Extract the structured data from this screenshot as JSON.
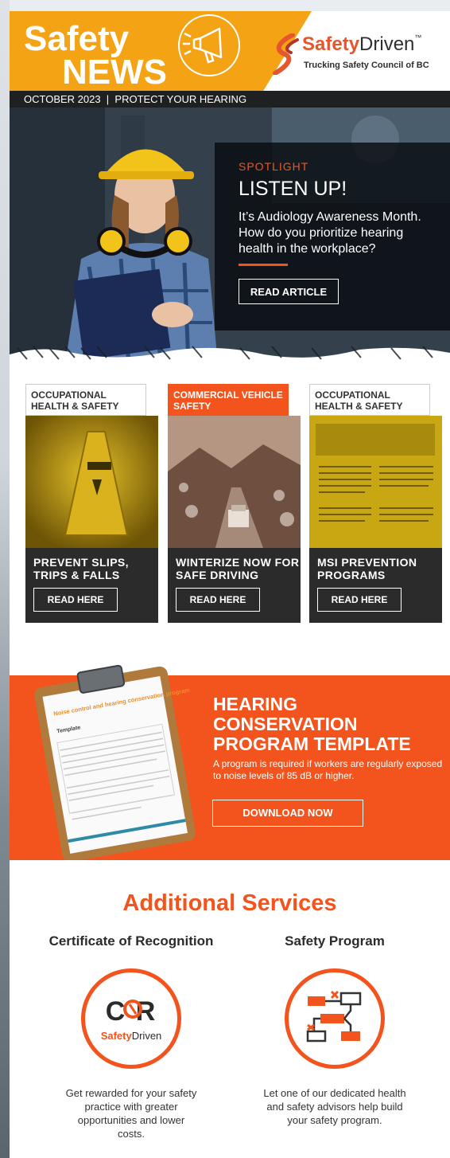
{
  "header": {
    "title_line1": "Safety",
    "title_line2": "NEWS",
    "brand_word1": "Safety",
    "brand_word2": "Driven",
    "brand_tm": "™",
    "brand_sub": "Trucking Safety Council of BC",
    "date_line": "OCTOBER 2023  |  PROTECT YOUR HEARING",
    "colors": {
      "orange": "#f3a313",
      "accent": "#f3541d",
      "dark": "#1f2022"
    }
  },
  "spotlight": {
    "label": "SPOTLIGHT",
    "title": "LISTEN UP!",
    "text": "It’s Audiology Awareness Month. How do you prioritize hearing health in the workplace?",
    "button": "READ ARTICLE"
  },
  "cards": [
    {
      "tab": "OCCUPATIONAL HEALTH & SAFETY",
      "heading": "PREVENT SLIPS, TRIPS & FALLS",
      "button": "READ HERE",
      "tab_style": "white",
      "image_icon": "caution-sign-image"
    },
    {
      "tab": "COMMERCIAL VEHICLE SAFETY",
      "heading": "WINTERIZE NOW FOR SAFE DRIVING",
      "button": "READ HERE",
      "tab_style": "orange",
      "image_icon": "winter-truck-image"
    },
    {
      "tab": "OCCUPATIONAL HEALTH & SAFETY",
      "heading": "MSI PREVENTION PROGRAMS",
      "button": "READ HERE",
      "tab_style": "white",
      "image_icon": "document-preview-image"
    }
  ],
  "hearing": {
    "title": "HEARING CONSERVATION PROGRAM TEMPLATE",
    "text": "A program is required if workers are regularly exposed to noise levels of 85 dB or higher.",
    "button": "DOWNLOAD NOW",
    "clipboard_doc_title": "Noise control and hearing conservation program",
    "clipboard_doc_sub": "Template"
  },
  "additional": {
    "title": "Additional Services",
    "services": [
      {
        "name": "Certificate of Recognition",
        "logo_text": "C R",
        "logo_sub1": "Safety",
        "logo_sub2": "Driven",
        "text": "Get rewarded for your safety practice with greater opportunities and lower costs.",
        "icon": "cor-logo-icon"
      },
      {
        "name": "Safety Program",
        "text": "Let one of our dedicated health and safety advisors help build your safety program.",
        "icon": "program-flowchart-icon"
      }
    ]
  }
}
